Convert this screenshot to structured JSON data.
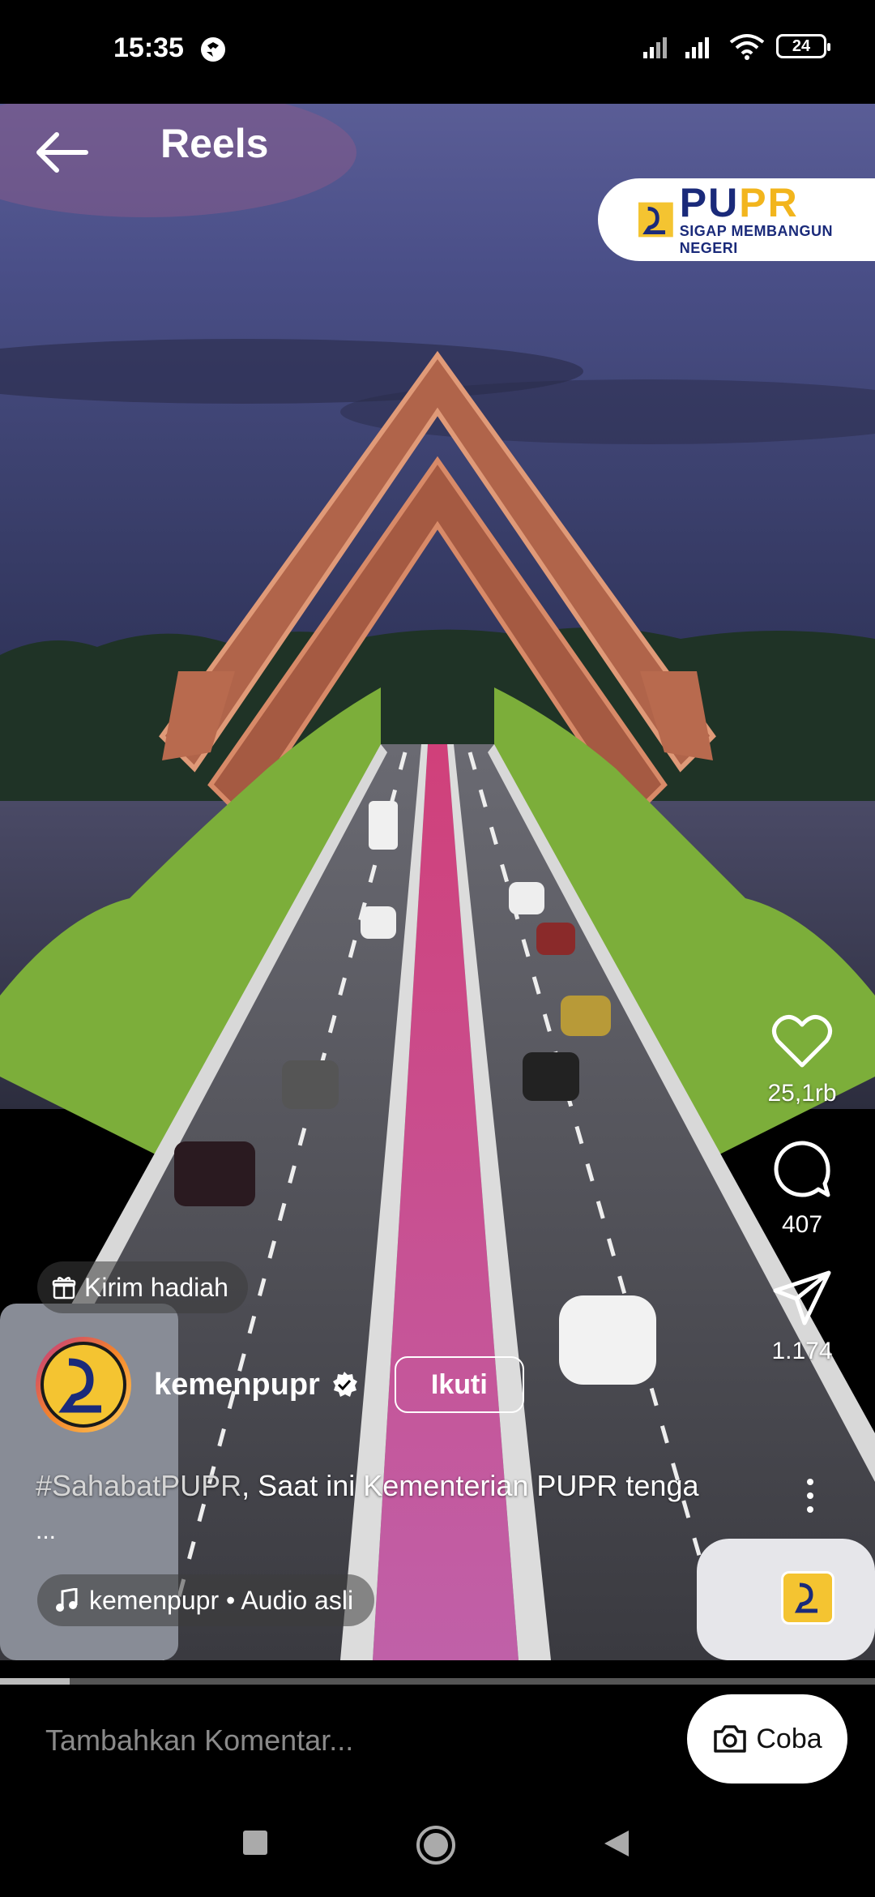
{
  "status_bar": {
    "time": "15:35",
    "battery": "24"
  },
  "header": {
    "title": "Reels"
  },
  "brand_badge": {
    "name_main": "PU",
    "name_accent": "PR",
    "tagline": "SIGAP MEMBANGUN NEGERI"
  },
  "actions": {
    "likes": "25,1rb",
    "comments": "407",
    "shares": "1.174"
  },
  "gift": {
    "label": "Kirim hadiah"
  },
  "profile": {
    "username": "kemenpupr",
    "follow_label": "Ikuti"
  },
  "caption": {
    "hashtag": "#SahabatPUPR",
    "text": ", Saat ini Kementerian PUPR tenga",
    "more": "..."
  },
  "audio": {
    "label": "kemenpupr • Audio asli"
  },
  "progress": {
    "fraction": 0.08
  },
  "comment": {
    "placeholder": "Tambahkan Komentar...",
    "try_label": "Coba"
  },
  "icons": {
    "back": "arrow-left-icon",
    "heart": "heart-icon",
    "comment": "comment-bubble-icon",
    "share": "paper-plane-icon",
    "more": "more-vertical-icon",
    "music": "music-note-icon",
    "gift": "gift-icon",
    "verified": "verified-badge-icon",
    "camera": "camera-icon"
  }
}
